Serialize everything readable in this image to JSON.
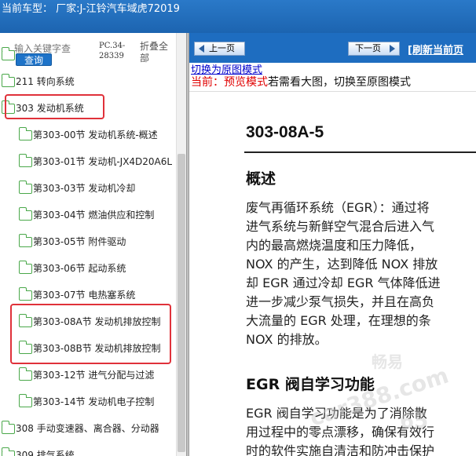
{
  "title": "当前车型： 厂家:J-江铃汽车域虎72019",
  "search": {
    "placeholder": "输入关键字查",
    "query_label": "查询",
    "pc_code": "PC.34-28339",
    "collapse_label": "折叠全部"
  },
  "tree": [
    {
      "label": "211 转向系统",
      "level": 0
    },
    {
      "label": "303 发动机系统",
      "level": 0
    },
    {
      "label": "第303-00节 发动机系统-概述",
      "level": 1
    },
    {
      "label": "第303-01节 发动机-JX4D20A6L",
      "level": 1
    },
    {
      "label": "第303-03节 发动机冷却",
      "level": 1
    },
    {
      "label": "第303-04节 燃油供应和控制",
      "level": 1
    },
    {
      "label": "第303-05节 附件驱动",
      "level": 1
    },
    {
      "label": "第303-06节 起动系统",
      "level": 1
    },
    {
      "label": "第303-07节 电热塞系统",
      "level": 1
    },
    {
      "label": "第303-08A节 发动机排放控制",
      "level": 1
    },
    {
      "label": "第303-08B节 发动机排放控制",
      "level": 1
    },
    {
      "label": "第303-12节 进气分配与过滤",
      "level": 1
    },
    {
      "label": "第303-14节 发动机电子控制",
      "level": 1
    },
    {
      "label": "308 手动变速器、离合器、分动器",
      "level": 0
    },
    {
      "label": "309 排气系统",
      "level": 0
    }
  ],
  "toolbar": {
    "prev_label": "上一页",
    "next_label": "下一页",
    "refresh_label": "[刷新当前页"
  },
  "content": {
    "switch_link": "切换为原图模式",
    "mode_prefix": "当前：",
    "mode_current": "预览模式",
    "mode_suffix": "若需看大图，切换至原图模式",
    "page_number": "303-08A-5",
    "heading": "概述",
    "paragraph": [
      "废气再循环系统（EGR）：通过将",
      "进气系统与新鲜空气混合后进入气",
      "内的最高燃烧温度和压力降低，",
      "NOX 的产生，达到降低 NOX 排放",
      "却 EGR 通过冷却 EGR 气体降低进",
      "进一步减少泵气损失，并且在高负",
      "大流量的 EGR 处理，在理想的条",
      "NOX 的排放。"
    ],
    "heading2": "EGR 阀自学习功能",
    "paragraph2": [
      "EGR 阀自学习功能是为了消除散",
      "用过程中的零点漂移，确保有效行",
      "时的软件实施自清洁和防冲击保护"
    ],
    "watermark_brand": "畅易",
    "watermark_url": "car388.com",
    "watermark_num": "65"
  },
  "colors": {
    "titlebar": "#1c64b0",
    "toolbar": "#1e6dc0",
    "highlight": "#e0313a",
    "folder": "#4aa84a",
    "mode_red": "#e00000",
    "link_blue": "#0000cc"
  }
}
